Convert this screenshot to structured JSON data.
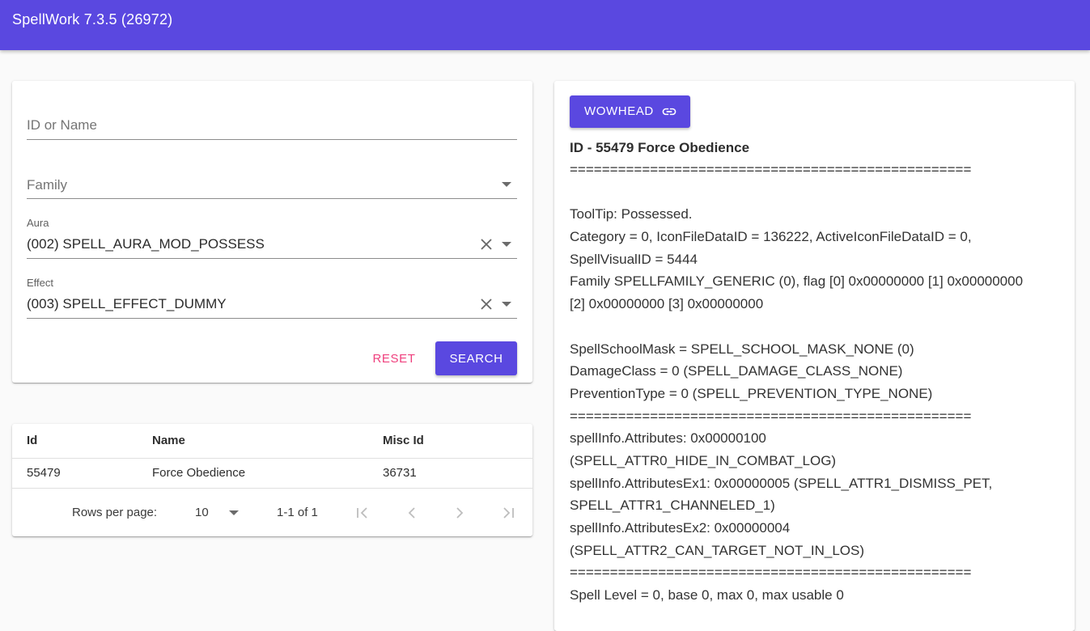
{
  "app": {
    "title": "SpellWork 7.3.5 (26972)"
  },
  "search": {
    "id_placeholder": "ID or Name",
    "family_placeholder": "Family",
    "aura_label": "Aura",
    "aura_value": "(002) SPELL_AURA_MOD_POSSESS",
    "effect_label": "Effect",
    "effect_value": "(003) SPELL_EFFECT_DUMMY",
    "reset_label": "RESET",
    "search_label": "SEARCH"
  },
  "results": {
    "columns": [
      "Id",
      "Name",
      "Misc Id"
    ],
    "rows": [
      {
        "id": "55479",
        "name": "Force Obedience",
        "misc_id": "36731"
      }
    ],
    "rows_per_page_label": "Rows per page:",
    "rows_per_page_value": "10",
    "range_text": "1-1 of 1"
  },
  "detail": {
    "wowhead_label": "WOWHEAD",
    "title": "ID - 55479 Force Obedience",
    "lines": [
      "==================================================",
      "",
      "ToolTip: Possessed.",
      "Category = 0, IconFileDataID = 136222, ActiveIconFileDataID = 0,",
      "SpellVisualID = 5444",
      "Family SPELLFAMILY_GENERIC (0), flag [0] 0x00000000 [1] 0x00000000",
      "[2] 0x00000000 [3] 0x00000000",
      "",
      "SpellSchoolMask = SPELL_SCHOOL_MASK_NONE (0)",
      "DamageClass = 0 (SPELL_DAMAGE_CLASS_NONE)",
      "PreventionType = 0 (SPELL_PREVENTION_TYPE_NONE)",
      "==================================================",
      "spellInfo.Attributes: 0x00000100",
      "(SPELL_ATTR0_HIDE_IN_COMBAT_LOG)",
      "spellInfo.AttributesEx1: 0x00000005 (SPELL_ATTR1_DISMISS_PET,",
      "SPELL_ATTR1_CHANNELED_1)",
      "spellInfo.AttributesEx2: 0x00000004",
      "(SPELL_ATTR2_CAN_TARGET_NOT_IN_LOS)",
      "==================================================",
      "Spell Level = 0, base 0, max 0, max usable 0"
    ]
  },
  "colors": {
    "primary": "#5a48e0",
    "accent": "#ef3f7d"
  },
  "icons": [
    "link-icon",
    "clear-icon",
    "dropdown-arrow-icon",
    "first-page-icon",
    "prev-page-icon",
    "next-page-icon",
    "last-page-icon"
  ]
}
